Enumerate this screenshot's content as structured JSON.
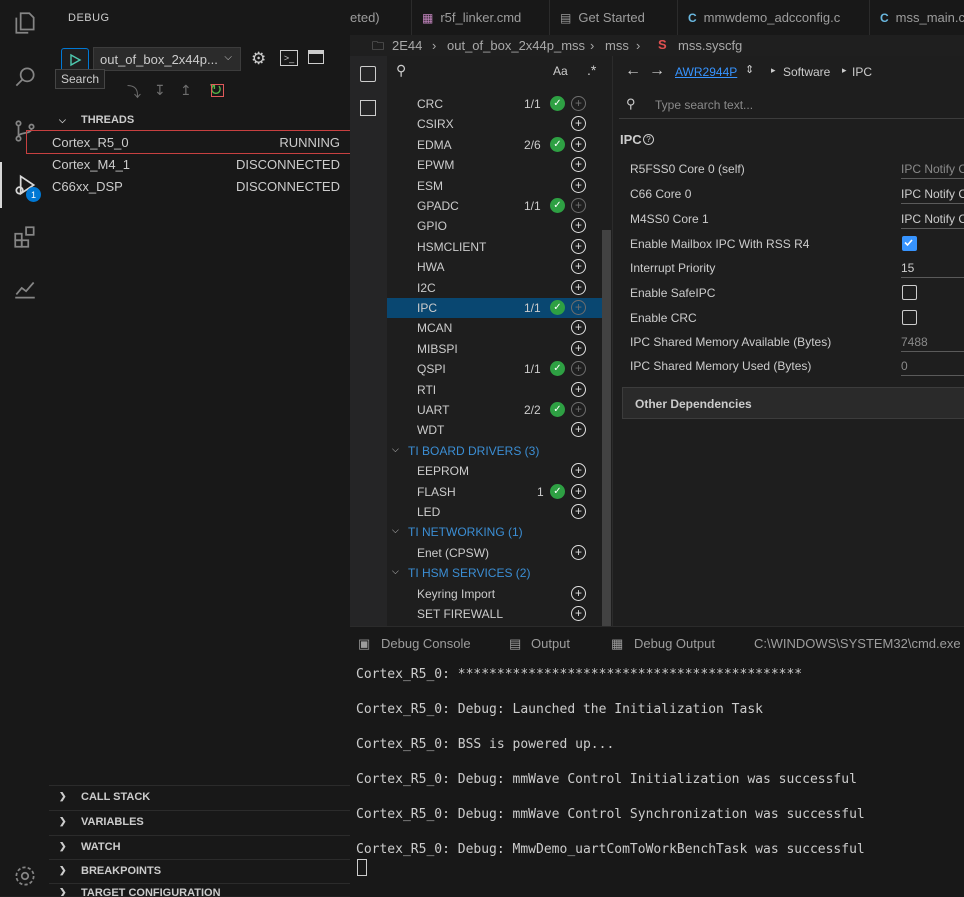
{
  "sidebar": {
    "title": "DEBUG",
    "config_name": "out_of_box_2x44p...",
    "tooltip": "Search",
    "sections": {
      "threads": "THREADS",
      "call_stack": "CALL STACK",
      "variables": "VARIABLES",
      "watch": "WATCH",
      "breakpoints": "BREAKPOINTS",
      "target_configuration": "TARGET CONFIGURATION"
    },
    "threads": [
      {
        "name": "Cortex_R5_0",
        "status": "RUNNING"
      },
      {
        "name": "Cortex_M4_1",
        "status": "DISCONNECTED"
      },
      {
        "name": "C66xx_DSP",
        "status": "DISCONNECTED"
      }
    ],
    "badge_count": "1"
  },
  "tabs": [
    {
      "label": "eted)",
      "icon": ""
    },
    {
      "label": "r5f_linker.cmd",
      "icon": "file-icon"
    },
    {
      "label": "Get Started",
      "icon": "book-icon"
    },
    {
      "label": "mmwdemo_adcconfig.c",
      "icon": "c-file-icon"
    },
    {
      "label": "mss_main.c",
      "icon": "c-file-icon"
    }
  ],
  "breadcrumb": [
    "2E44",
    "out_of_box_2x44p_mss",
    "mss",
    "mss.syscfg"
  ],
  "modules": {
    "search_hint": "Aa",
    "items": [
      {
        "name": "CRC",
        "count": "1/1",
        "checked": true
      },
      {
        "name": "CSIRX",
        "count": "",
        "checked": false
      },
      {
        "name": "EDMA",
        "count": "2/6",
        "checked": true
      },
      {
        "name": "EPWM",
        "count": "",
        "checked": false
      },
      {
        "name": "ESM",
        "count": "",
        "checked": false
      },
      {
        "name": "GPADC",
        "count": "1/1",
        "checked": true
      },
      {
        "name": "GPIO",
        "count": "",
        "checked": false
      },
      {
        "name": "HSMCLIENT",
        "count": "",
        "checked": false
      },
      {
        "name": "HWA",
        "count": "",
        "checked": false
      },
      {
        "name": "I2C",
        "count": "",
        "checked": false
      },
      {
        "name": "IPC",
        "count": "1/1",
        "checked": true
      },
      {
        "name": "MCAN",
        "count": "",
        "checked": false
      },
      {
        "name": "MIBSPI",
        "count": "",
        "checked": false
      },
      {
        "name": "QSPI",
        "count": "1/1",
        "checked": true
      },
      {
        "name": "RTI",
        "count": "",
        "checked": false
      },
      {
        "name": "UART",
        "count": "2/2",
        "checked": true
      },
      {
        "name": "WDT",
        "count": "",
        "checked": false
      }
    ],
    "groups": [
      {
        "name": "TI BOARD DRIVERS (3)",
        "items": [
          {
            "name": "EEPROM",
            "count": "",
            "checked": false
          },
          {
            "name": "FLASH",
            "count": "1",
            "checked": true
          },
          {
            "name": "LED",
            "count": "",
            "checked": false
          }
        ]
      },
      {
        "name": "TI NETWORKING (1)",
        "items": [
          {
            "name": "Enet (CPSW)",
            "count": "",
            "checked": false
          }
        ]
      },
      {
        "name": "TI HSM SERVICES (2)",
        "items": [
          {
            "name": "Keyring Import",
            "count": "",
            "checked": false
          },
          {
            "name": "SET FIREWALL",
            "count": "",
            "checked": false
          }
        ]
      }
    ]
  },
  "config": {
    "device": "AWR2944P",
    "crumb": [
      "Software",
      "IPC"
    ],
    "search_placeholder": "Type search text...",
    "section_title": "IPC",
    "props": [
      {
        "label": "R5FSS0 Core 0 (self)",
        "value": "IPC Notify C",
        "type": "text",
        "readonly": true
      },
      {
        "label": "C66 Core 0",
        "value": "IPC Notify C",
        "type": "text",
        "readonly": false
      },
      {
        "label": "M4SS0 Core 1",
        "value": "IPC Notify C",
        "type": "text",
        "readonly": false
      },
      {
        "label": "Enable Mailbox IPC With RSS R4",
        "value": true,
        "type": "checkbox"
      },
      {
        "label": "Interrupt Priority",
        "value": "15",
        "type": "text",
        "readonly": false
      },
      {
        "label": "Enable SafeIPC",
        "value": false,
        "type": "checkbox"
      },
      {
        "label": "Enable CRC",
        "value": false,
        "type": "checkbox"
      },
      {
        "label": "IPC Shared Memory Available (Bytes)",
        "value": "7488",
        "type": "text",
        "readonly": true
      },
      {
        "label": "IPC Shared Memory Used (Bytes)",
        "value": "0",
        "type": "text",
        "readonly": true
      }
    ],
    "other_dependencies": "Other Dependencies"
  },
  "panel": {
    "tabs": [
      "Debug Console",
      "Output",
      "Debug Output",
      "C:\\WINDOWS\\SYSTEM32\\cmd.exe"
    ],
    "lines": [
      "Cortex_R5_0: ********************************************",
      "Cortex_R5_0: Debug: Launched the Initialization Task",
      "Cortex_R5_0: BSS is powered up...",
      "Cortex_R5_0: Debug: mmWave Control Initialization was successful",
      "Cortex_R5_0: Debug: mmWave Control Synchronization was successful",
      "Cortex_R5_0: Debug: MmwDemo_uartComToWorkBenchTask was successful"
    ]
  }
}
